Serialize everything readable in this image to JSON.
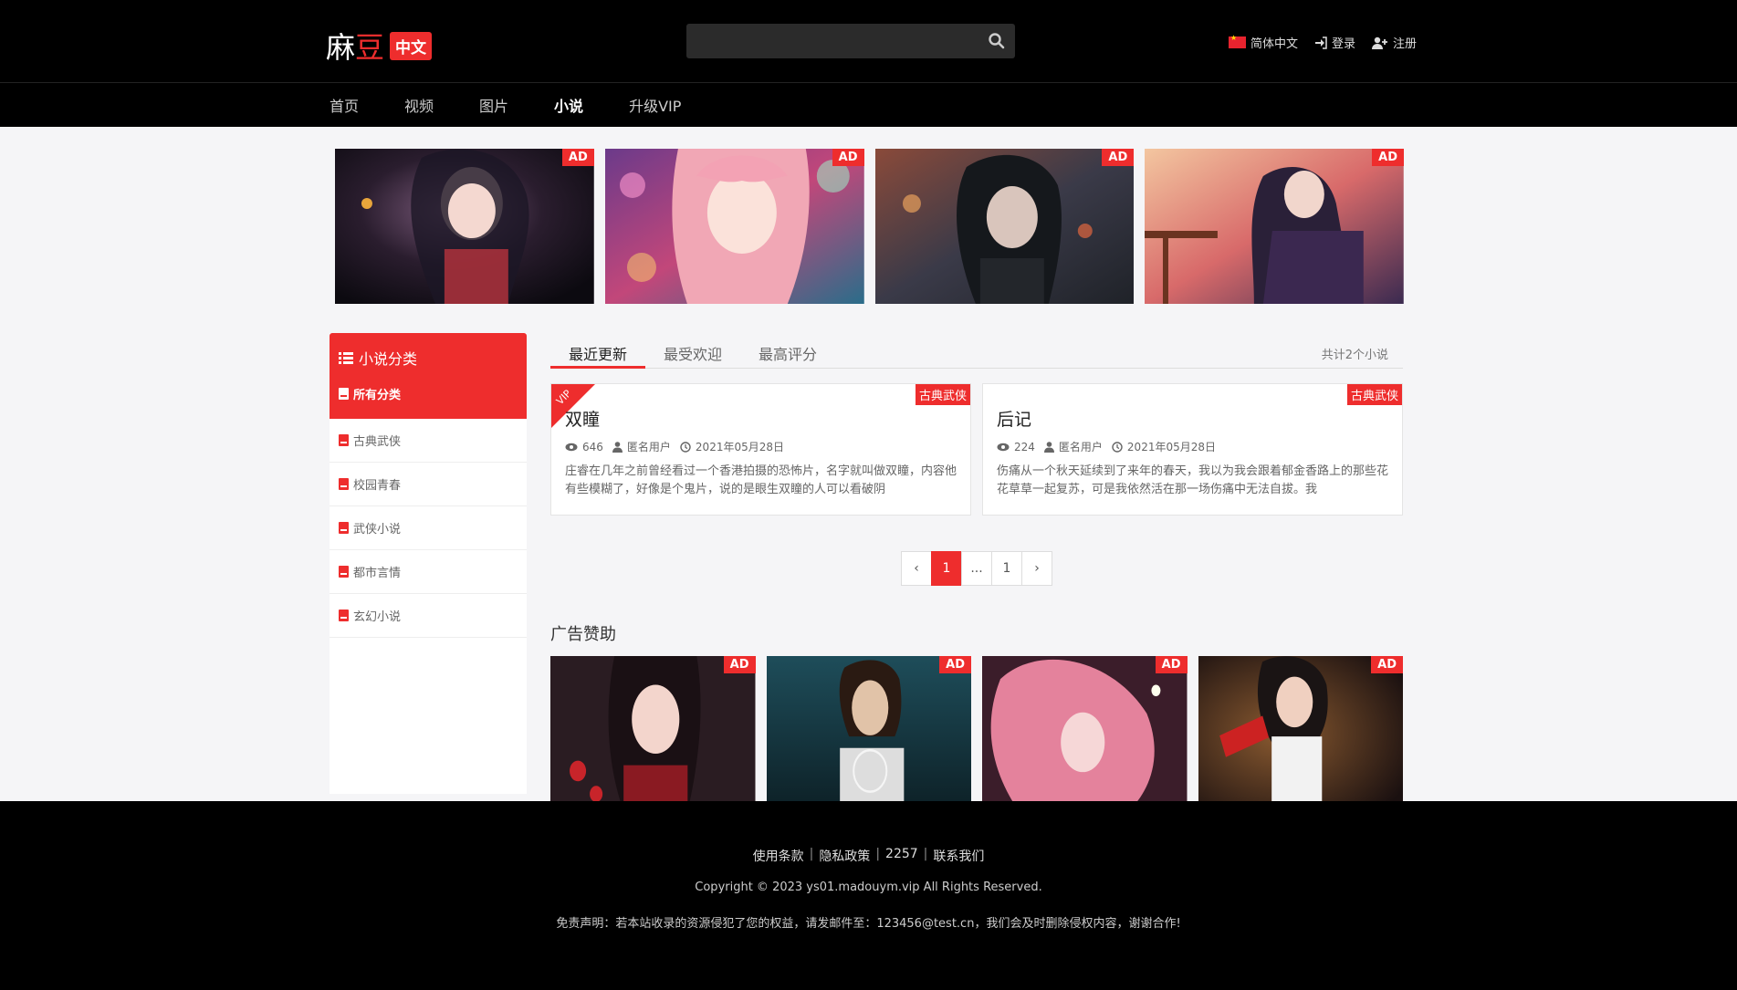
{
  "header": {
    "logo_part1": "麻",
    "logo_part2": "豆",
    "logo_badge": "中文",
    "search_placeholder": "",
    "language": "简体中文",
    "login": "登录",
    "register": "注册"
  },
  "nav": {
    "items": [
      "首页",
      "视频",
      "图片",
      "小说",
      "升级VIP"
    ],
    "active_index": 3
  },
  "top_ads": {
    "tag": "AD",
    "count": 4
  },
  "sidebar": {
    "title": "小说分类",
    "all_label": "所有分类",
    "items": [
      "古典武侠",
      "校园青春",
      "武侠小说",
      "都市言情",
      "玄幻小说"
    ]
  },
  "tabs": {
    "items": [
      "最近更新",
      "最受欢迎",
      "最高评分"
    ],
    "active_index": 0,
    "count_text": "共计2个小说"
  },
  "novels": [
    {
      "title": "双瞳",
      "category": "古典武侠",
      "vip": "VIP",
      "views": "646",
      "author": "匿名用户",
      "date": "2021年05月28日",
      "excerpt": "庄睿在几年之前曾经看过一个香港拍摄的恐怖片，名字就叫做双瞳，内容他有些模糊了，好像是个鬼片，说的是眼生双瞳的人可以看破阴"
    },
    {
      "title": "后记",
      "category": "古典武侠",
      "vip": "",
      "views": "224",
      "author": "匿名用户",
      "date": "2021年05月28日",
      "excerpt": "伤痛从一个秋天延续到了来年的春天，我以为我会跟着郁金香路上的那些花花草草一起复苏，可是我依然活在那一场伤痛中无法自拔。我"
    }
  ],
  "pagination": {
    "prev": "‹",
    "current": "1",
    "ellipsis": "...",
    "last": "1",
    "next": "›"
  },
  "sponsor": {
    "title": "广告赞助",
    "tag": "AD"
  },
  "footer": {
    "links": [
      "使用条款",
      "隐私政策",
      "2257",
      "联系我们"
    ],
    "copyright": "Copyright © 2023 ys01.madouym.vip All Rights Reserved.",
    "disclaimer": "免责声明：若本站收录的资源侵犯了您的权益，请发邮件至：123456@test.cn，我们会及时删除侵权内容，谢谢合作!"
  },
  "colors": {
    "accent": "#ee2d2d",
    "header_bg": "#000000",
    "page_bg": "#f5f5f7"
  }
}
